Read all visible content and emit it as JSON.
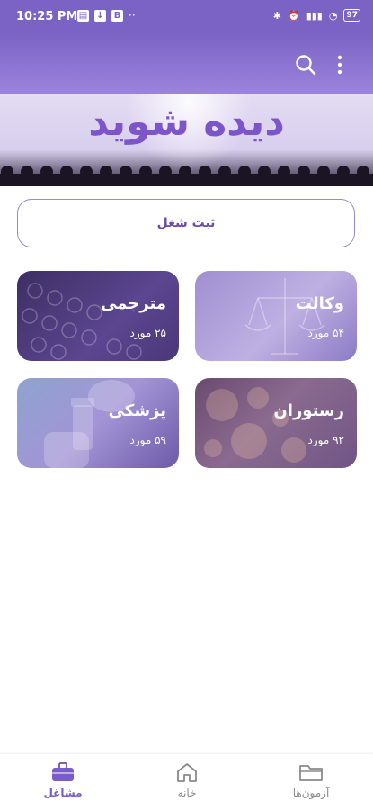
{
  "status_bar": {
    "time": "10:25 PM",
    "battery": "97",
    "b_icon_label": "B",
    "dots": "··"
  },
  "banner": {
    "logo_text": "دیده شوید"
  },
  "register_button": {
    "label": "ثبت شغل"
  },
  "categories": [
    {
      "title": "مترجمی",
      "count": "۲۵ مورد"
    },
    {
      "title": "وکالت",
      "count": "۵۴ مورد"
    },
    {
      "title": "پزشکی",
      "count": "۵۹ مورد"
    },
    {
      "title": "رستوران",
      "count": "۹۲ مورد"
    }
  ],
  "bottom_nav": {
    "jobs": "مشاغل",
    "home": "خانه",
    "tests": "آزمون‌ها"
  },
  "colors": {
    "primary": "#7b63c5",
    "accent": "#7a5cc6"
  }
}
